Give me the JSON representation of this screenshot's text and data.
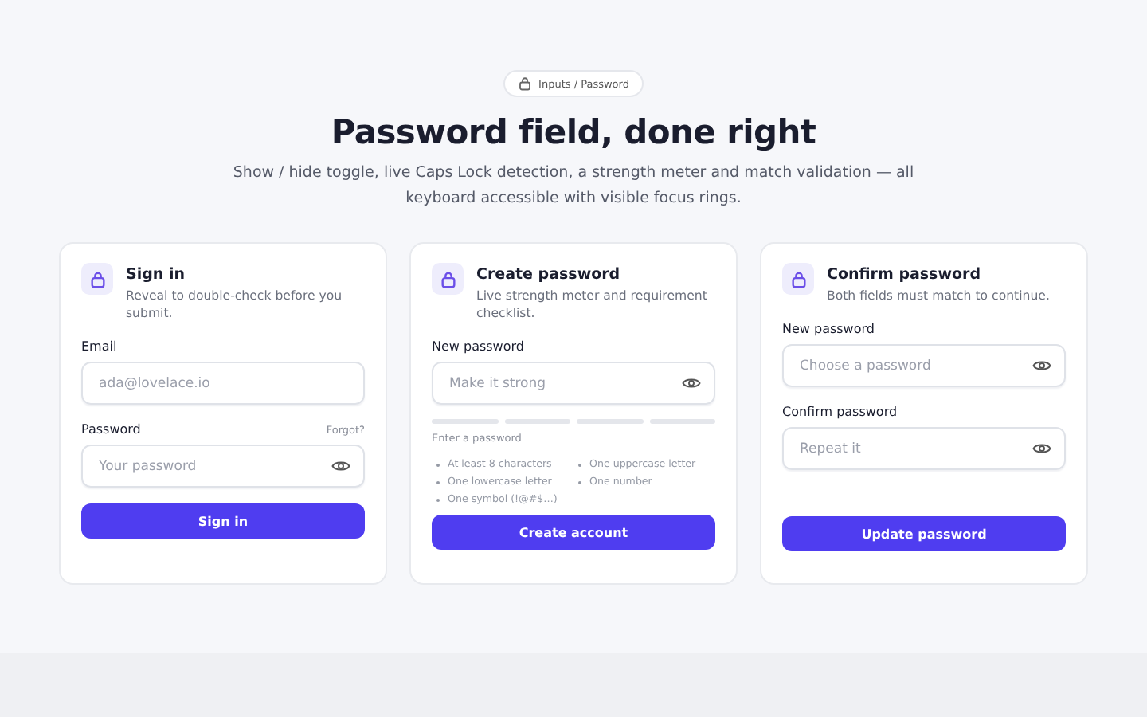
{
  "badge": "Inputs / Password",
  "title": "Password field, done right",
  "subtitle": "Show / hide toggle, live Caps Lock detection, a strength meter and match validation — all keyboard accessible with visible focus rings.",
  "cards": [
    {
      "title": "Sign in",
      "description": "Reveal to double-check before you submit.",
      "fields": [
        {
          "label": "Email",
          "placeholder": "ada@lovelace.io",
          "reveal": false
        },
        {
          "label": "Password",
          "link": "Forgot?",
          "placeholder": "Your password",
          "reveal": true
        }
      ],
      "button": "Sign in"
    },
    {
      "title": "Create password",
      "description": "Live strength meter and requirement checklist.",
      "fields": [
        {
          "label": "New password",
          "placeholder": "Make it strong",
          "reveal": true
        }
      ],
      "meter": {
        "hint": "Enter a password"
      },
      "requirements": [
        {
          "text": "At least 8 characters",
          "met": false
        },
        {
          "text": "One uppercase letter",
          "met": false
        },
        {
          "text": "One lowercase letter",
          "met": false
        },
        {
          "text": "One number",
          "met": false
        },
        {
          "text": "One symbol (!@#$…)",
          "met": false
        }
      ],
      "button": "Create account"
    },
    {
      "title": "Confirm password",
      "description": "Both fields must match to continue.",
      "fields": [
        {
          "label": "New password",
          "placeholder": "Choose a password",
          "reveal": true
        },
        {
          "label": "Confirm password",
          "placeholder": "Repeat it",
          "reveal": true
        }
      ],
      "button": "Update password"
    }
  ]
}
